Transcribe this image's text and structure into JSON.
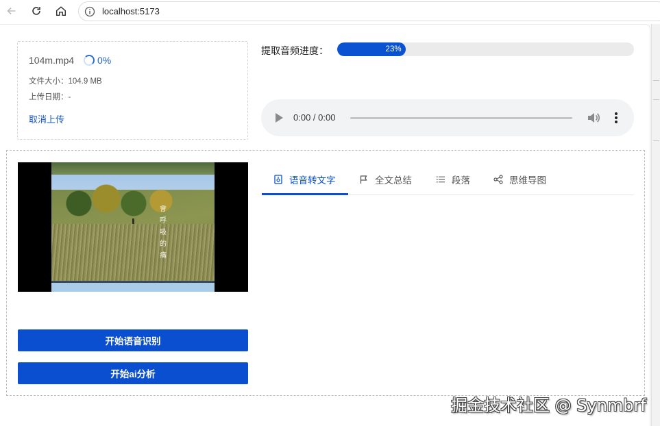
{
  "browser": {
    "url": "localhost:5173"
  },
  "upload": {
    "file_name": "104m.mp4",
    "percent": "0%",
    "size_line": "文件大小：104.9 MB",
    "date_line": "上传日期：-",
    "cancel_label": "取消上传"
  },
  "progress": {
    "label": "提取音频进度：",
    "value_text": "23%",
    "value": 0.23
  },
  "audio": {
    "time": "0:00 / 0:00"
  },
  "video": {
    "subtitle": "會呼吸的痛"
  },
  "actions": {
    "start_recognition": "开始语音识别",
    "start_ai": "开始ai分析"
  },
  "tabs": [
    {
      "label": "语音转文字",
      "icon": "file-audio-icon",
      "active": true
    },
    {
      "label": "全文总结",
      "icon": "flag-icon",
      "active": false
    },
    {
      "label": "段落",
      "icon": "list-icon",
      "active": false
    },
    {
      "label": "思维导图",
      "icon": "share-nodes-icon",
      "active": false
    }
  ],
  "watermark": "掘金技术社区 @ Synmbrf",
  "colors": {
    "primary": "#0a4fd0",
    "link": "#1a5bc4"
  }
}
